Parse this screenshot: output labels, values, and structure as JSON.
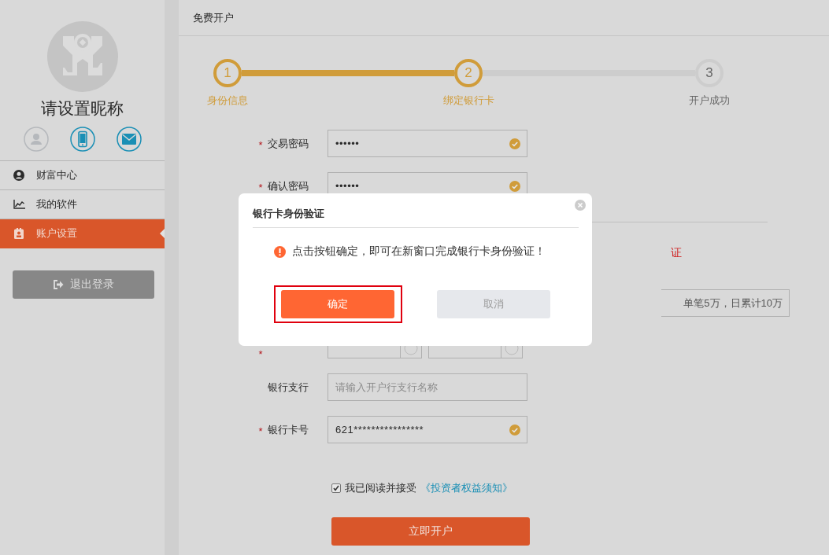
{
  "sidebar": {
    "nickname": "请设置昵称",
    "bindings": [
      {
        "kind": "person",
        "bound": false
      },
      {
        "kind": "phone",
        "bound": true
      },
      {
        "kind": "mail",
        "bound": true
      }
    ],
    "menu": [
      {
        "label": "财富中心",
        "selected": false
      },
      {
        "label": "我的软件",
        "selected": false
      },
      {
        "label": "账户设置",
        "selected": true
      }
    ],
    "logout": "退出登录"
  },
  "page": {
    "title": "免费开户"
  },
  "steps": [
    {
      "number": "1",
      "label": "身份信息",
      "done": true
    },
    {
      "number": "2",
      "label": "绑定银行卡",
      "done": true
    },
    {
      "number": "3",
      "label": "开户成功",
      "done": false
    }
  ],
  "form": {
    "rows": [
      {
        "kind": "input",
        "label": "交易密码",
        "required_mark": "*",
        "value": "••••••",
        "valid": true
      },
      {
        "kind": "input",
        "label": "确认密码",
        "required_mark": "*",
        "value": "••••••",
        "valid": true
      },
      {
        "kind": "note",
        "text": "证"
      },
      {
        "kind": "limit",
        "text": "单笔5万，日累计10万"
      },
      {
        "kind": "selects",
        "required_mark": "*"
      },
      {
        "kind": "input",
        "label": "银行支行",
        "placeholder": "请输入开户行支行名称",
        "valid": false
      },
      {
        "kind": "input",
        "label": "银行卡号",
        "required_mark": "*",
        "value": "621****************",
        "valid": true
      }
    ],
    "agreement": {
      "checked": true,
      "text": "我已阅读并接受",
      "link": "《投资者权益须知》"
    },
    "submit": "立即开户"
  },
  "dialog": {
    "title": "银行卡身份验证",
    "message": "点击按钮确定，即可在新窗口完成银行卡身份验证！",
    "confirm": "确定",
    "cancel": "取消",
    "highlighted": true
  }
}
